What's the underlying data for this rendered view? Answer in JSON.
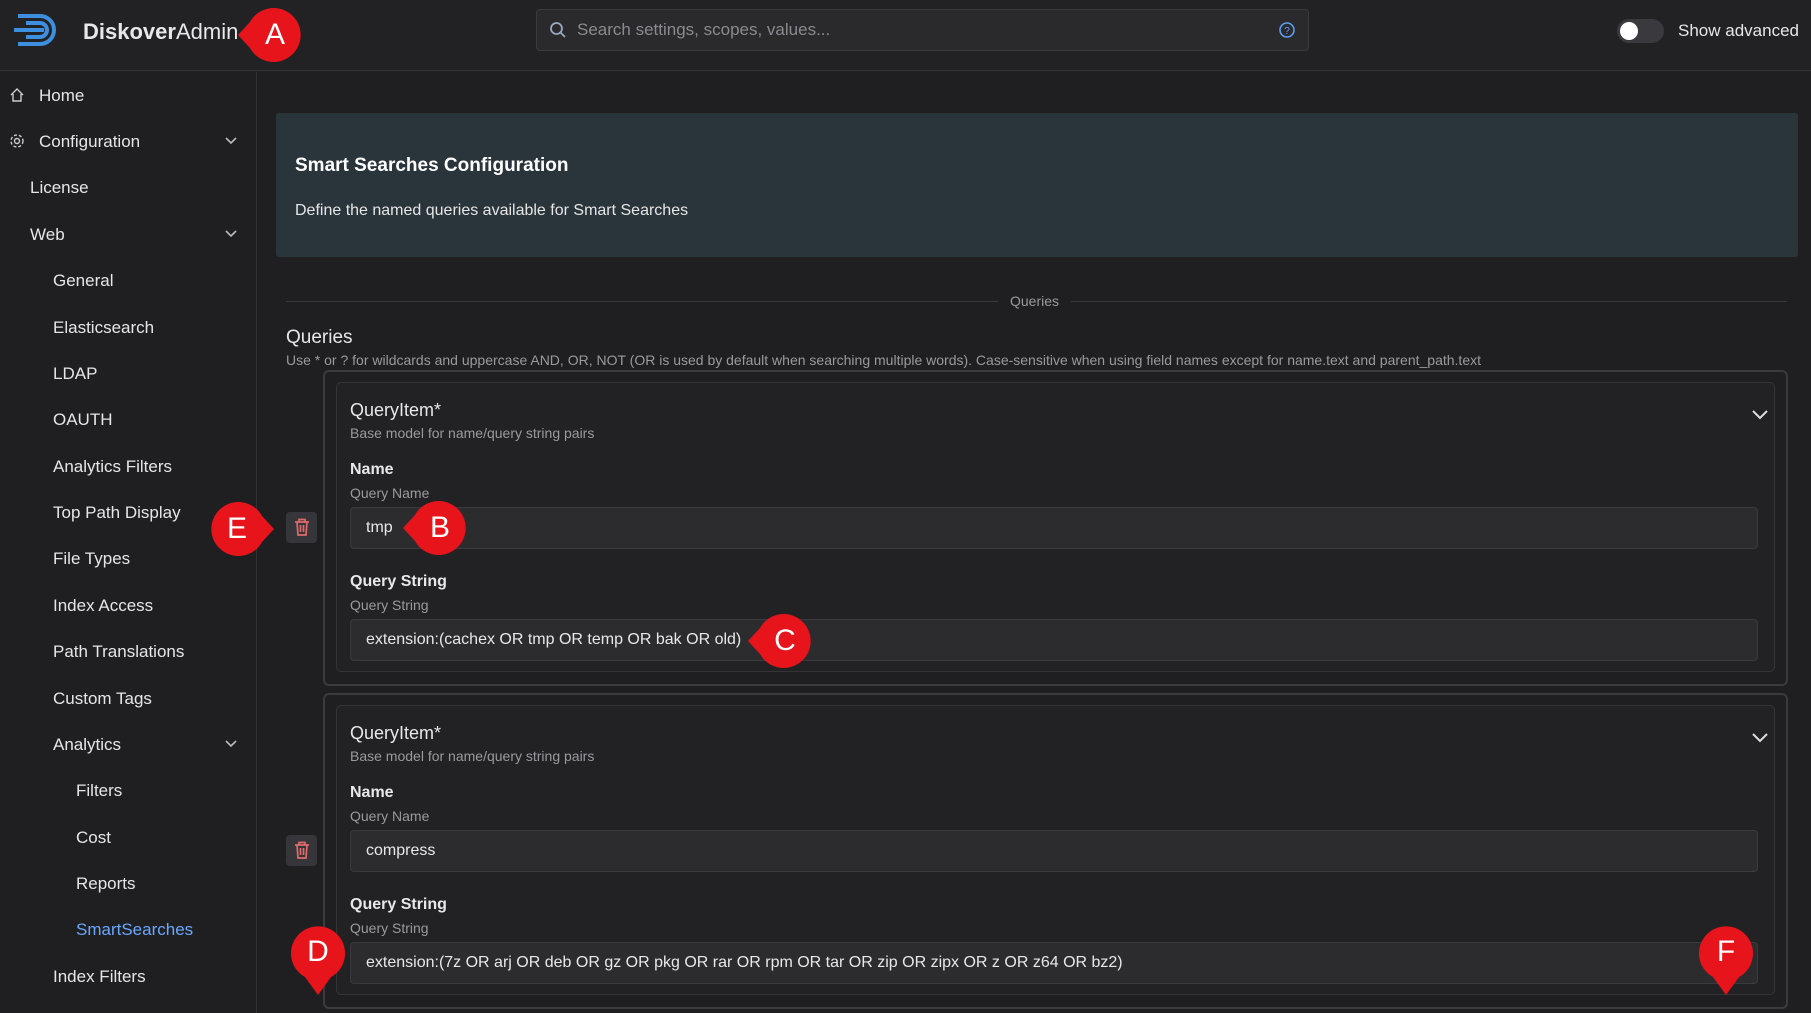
{
  "header": {
    "brand_bold": "Diskover",
    "brand_light": "Admin",
    "search_placeholder": "Search settings, scopes, values...",
    "toggle_label": "Show advanced",
    "toggle_on": false
  },
  "sidebar": {
    "items": [
      {
        "label": "Home",
        "icon": "home-icon"
      },
      {
        "label": "Configuration",
        "icon": "gear-icon",
        "expanded": true
      },
      {
        "label": "License"
      },
      {
        "label": "Web",
        "expanded": true
      },
      {
        "label": "General"
      },
      {
        "label": "Elasticsearch"
      },
      {
        "label": "LDAP"
      },
      {
        "label": "OAUTH"
      },
      {
        "label": "Analytics Filters"
      },
      {
        "label": "Top Path Display"
      },
      {
        "label": "File Types"
      },
      {
        "label": "Index Access"
      },
      {
        "label": "Path Translations"
      },
      {
        "label": "Custom Tags"
      },
      {
        "label": "Analytics",
        "expanded": true
      },
      {
        "label": "Filters"
      },
      {
        "label": "Cost"
      },
      {
        "label": "Reports"
      },
      {
        "label": "SmartSearches",
        "active": true
      },
      {
        "label": "Index Filters"
      }
    ]
  },
  "main": {
    "title": "Smart Searches Configuration",
    "description": "Define the named queries available for Smart Searches",
    "divider_label": "Queries",
    "section_title": "Queries",
    "section_desc": "Use * or ? for wildcards and uppercase AND, OR, NOT (OR is used by default when searching multiple words). Case-sensitive when using field names except for name.text and parent_path.text",
    "query_items": [
      {
        "title": "QueryItem*",
        "subtitle": "Base model for name/query string pairs",
        "name_label": "Name",
        "name_sub": "Query Name",
        "name_value": "tmp",
        "qs_label": "Query String",
        "qs_sub": "Query String",
        "qs_value": "extension:(cachex OR tmp OR temp OR bak OR old)"
      },
      {
        "title": "QueryItem*",
        "subtitle": "Base model for name/query string pairs",
        "name_label": "Name",
        "name_sub": "Query Name",
        "name_value": "compress",
        "qs_label": "Query String",
        "qs_sub": "Query String",
        "qs_value": "extension:(7z OR arj OR deb OR gz OR pkg OR rar OR rpm OR tar OR zip OR zipx OR z OR z64 OR bz2)"
      }
    ]
  },
  "markers": {
    "a": "A",
    "b": "B",
    "c": "C",
    "d": "D",
    "e": "E",
    "f": "F"
  },
  "colors": {
    "accent": "#6aa7ff",
    "marker": "#e8141c",
    "delete_icon": "#e06a6a"
  }
}
